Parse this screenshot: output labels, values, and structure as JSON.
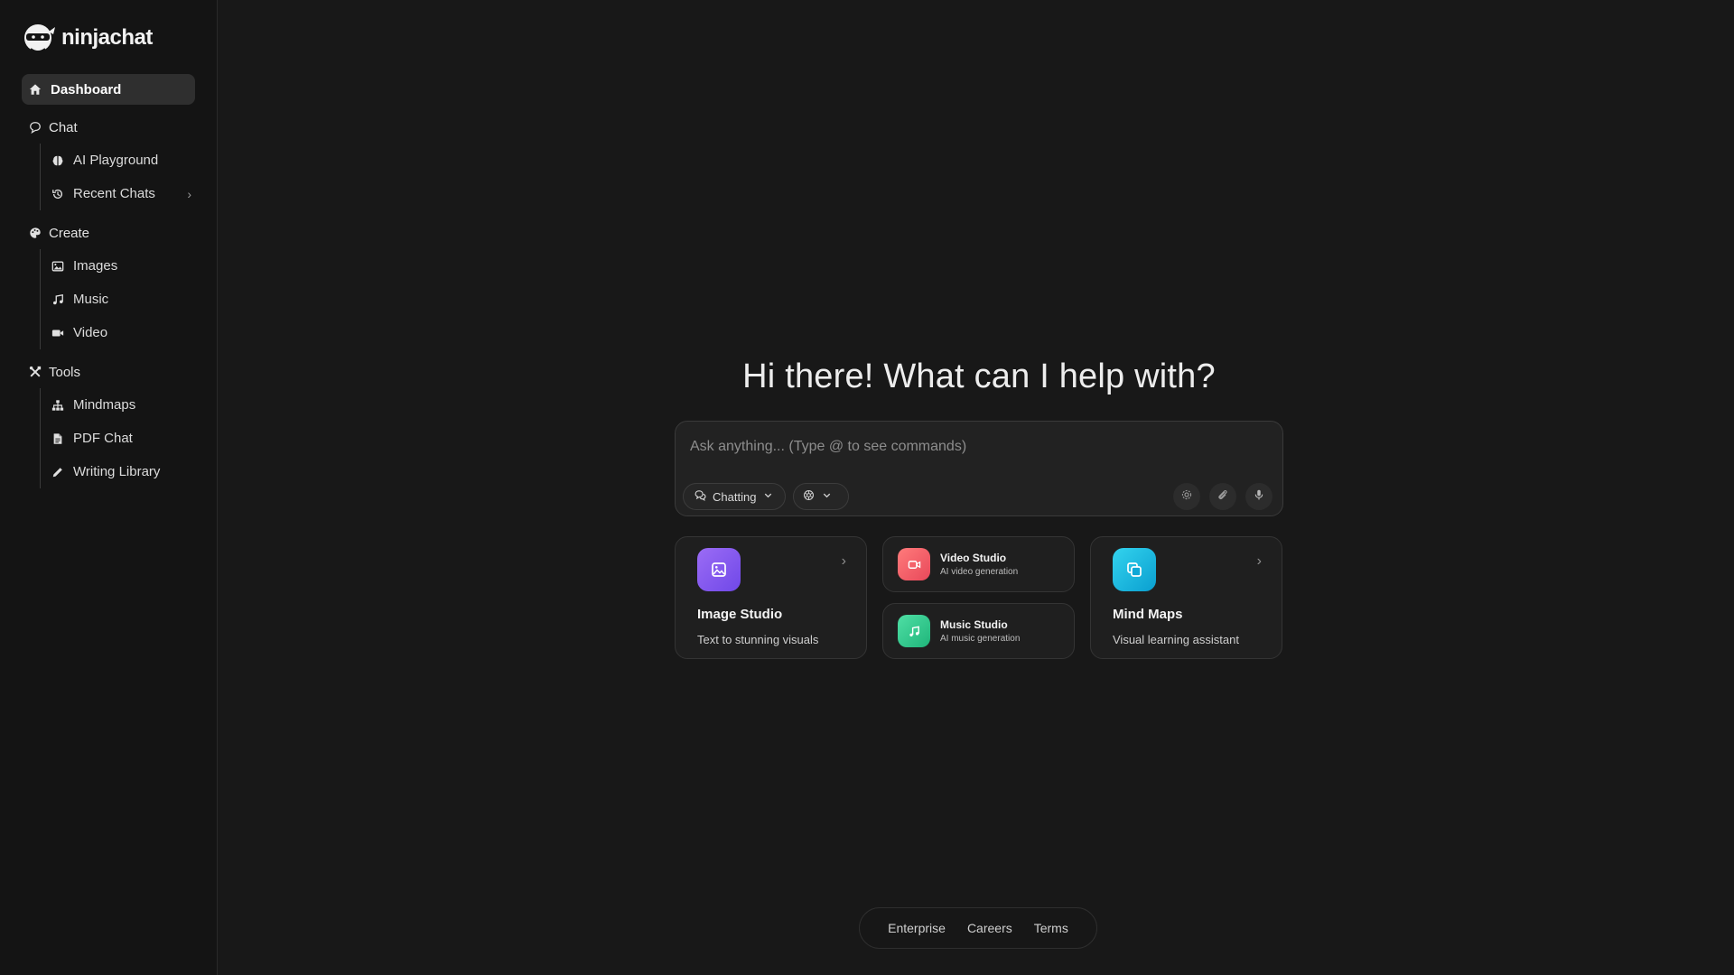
{
  "brand": {
    "name": "ninjachat",
    "logo_icon": "ninja-icon"
  },
  "nav": {
    "dashboard": {
      "label": "Dashboard",
      "icon": "home-icon"
    },
    "sections": [
      {
        "label": "Chat",
        "icon": "chat-bubble-icon",
        "items": [
          {
            "label": "AI Playground",
            "icon": "brain-icon"
          },
          {
            "label": "Recent Chats",
            "icon": "history-icon",
            "expandable": true
          }
        ]
      },
      {
        "label": "Create",
        "icon": "palette-icon",
        "items": [
          {
            "label": "Images",
            "icon": "image-icon"
          },
          {
            "label": "Music",
            "icon": "music-note-icon"
          },
          {
            "label": "Video",
            "icon": "video-camera-icon"
          }
        ]
      },
      {
        "label": "Tools",
        "icon": "tools-icon",
        "items": [
          {
            "label": "Mindmaps",
            "icon": "sitemap-icon"
          },
          {
            "label": "PDF Chat",
            "icon": "file-icon"
          },
          {
            "label": "Writing Library",
            "icon": "pencil-icon"
          }
        ]
      }
    ]
  },
  "main": {
    "greeting": "Hi there! What can I help with?",
    "chat": {
      "placeholder": "Ask anything... (Type @ to see commands)",
      "value": "",
      "mode_label": "Chatting",
      "model_icon": "openai-icon"
    },
    "cards": {
      "image_studio": {
        "title": "Image Studio",
        "subtitle": "Text to stunning visuals"
      },
      "video_studio": {
        "title": "Video Studio",
        "subtitle": "AI video generation"
      },
      "music_studio": {
        "title": "Music Studio",
        "subtitle": "AI music generation"
      },
      "mind_maps": {
        "title": "Mind Maps",
        "subtitle": "Visual learning assistant"
      }
    }
  },
  "footer": {
    "links": [
      "Enterprise",
      "Careers",
      "Terms"
    ]
  },
  "colors": {
    "background": "#181818",
    "sidebar": "#141414",
    "image_accent": "#7c55ee",
    "video_accent": "#f05a68",
    "music_accent": "#2bc487",
    "mind_accent": "#12b5e0"
  }
}
